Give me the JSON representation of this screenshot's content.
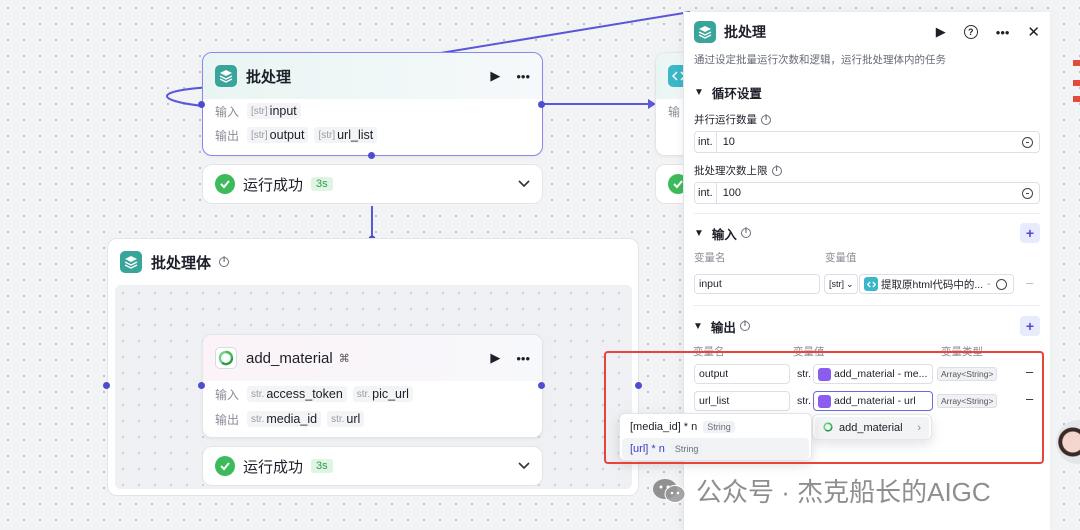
{
  "batch_node": {
    "title": "批处理",
    "input_label": "输入",
    "output_label": "输出",
    "input_type": "str",
    "input_var": "input",
    "outputs": [
      {
        "type": "str",
        "name": "output"
      },
      {
        "type": "str",
        "name": "url_list"
      }
    ],
    "status": "运行成功",
    "duration": "3s"
  },
  "code_node": {
    "input_label_partial": "输"
  },
  "batch_body": {
    "title": "批处理体"
  },
  "add_material_node": {
    "title": "add_material",
    "input_label": "输入",
    "output_label": "输出",
    "inputs": [
      {
        "type": "str.",
        "name": "access_token"
      },
      {
        "type": "str.",
        "name": "pic_url"
      }
    ],
    "outputs": [
      {
        "type": "str.",
        "name": "media_id"
      },
      {
        "type": "str.",
        "name": "url"
      }
    ],
    "status": "运行成功",
    "duration": "3s"
  },
  "dropdown": {
    "items": [
      {
        "label": "[media_id] * n",
        "type": "String"
      },
      {
        "label": "[url] * n",
        "type": "String"
      }
    ],
    "submenu_label": "add_material"
  },
  "panel": {
    "title": "批处理",
    "description": "通过设定批量运行次数和逻辑，运行批处理体内的任务",
    "loop_section": "循环设置",
    "parallel_label": "并行运行数量",
    "parallel_prefix": "int.",
    "parallel_value": "10",
    "max_label": "批处理次数上限",
    "max_prefix": "int.",
    "max_value": "100",
    "input_section": "输入",
    "col_var_name": "变量名",
    "col_var_value": "变量值",
    "col_var_type": "变量类型",
    "input_row": {
      "name": "input",
      "type_tag": "[str]",
      "ref": "提取原html代码中的..."
    },
    "output_section": "输出",
    "output_rows": [
      {
        "name": "output",
        "prefix": "str.",
        "ref": "add_material - me...",
        "type": "Array<String>"
      },
      {
        "name": "url_list",
        "prefix": "str.",
        "ref": "add_material - url",
        "type": "Array<String>"
      }
    ]
  },
  "watermark": {
    "text": "公众号 · 杰克船长的AIGC"
  },
  "colors": {
    "accent": "#4e4ccf",
    "success": "#3dbb5b",
    "highlight": "#e8443a",
    "teal": "#39a49a"
  },
  "icons": [
    "batch-icon",
    "code-icon",
    "add-material-icon",
    "play-icon",
    "more-icon",
    "help-icon",
    "close-icon",
    "check-icon",
    "chevron-down-icon",
    "info-icon",
    "plus-icon",
    "minus-icon",
    "wechat-icon"
  ]
}
